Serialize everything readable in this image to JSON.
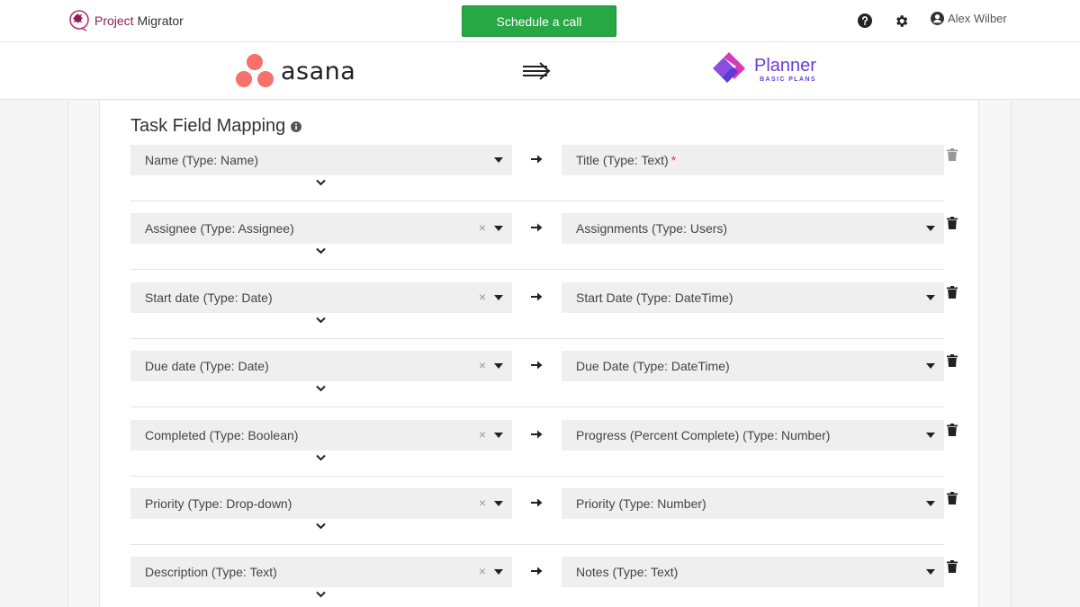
{
  "header": {
    "brand_part1": "Project",
    "brand_part2": "Migrator",
    "schedule_label": "Schedule a call",
    "user_name": "Alex Wilber"
  },
  "logos": {
    "source_name": "asana",
    "target_name": "Planner",
    "target_sub": "BASIC PLANS"
  },
  "section": {
    "title": "Task Field Mapping"
  },
  "mappings": [
    {
      "source": "Name (Type: Name)",
      "target": "Title (Type: Text)",
      "required": "*"
    },
    {
      "source": "Assignee (Type: Assignee)",
      "target": "Assignments (Type: Users)"
    },
    {
      "source": "Start date (Type: Date)",
      "target": "Start Date (Type: DateTime)"
    },
    {
      "source": "Due date (Type: Date)",
      "target": "Due Date (Type: DateTime)"
    },
    {
      "source": "Completed (Type: Boolean)",
      "target": "Progress (Percent Complete) (Type: Number)"
    },
    {
      "source": "Priority (Type: Drop-down)",
      "target": "Priority (Type: Number)"
    },
    {
      "source": "Description (Type: Text)",
      "target": "Notes (Type: Text)"
    }
  ],
  "icons": {
    "help": "question-circle-icon",
    "settings": "gear-icon",
    "user": "user-circle-icon",
    "info": "info-circle-icon",
    "map_arrow": "arrow-right-icon",
    "delete": "trash-icon",
    "expand": "chevron-down-icon",
    "clear": "clear-x-icon",
    "dropdown": "caret-down-icon"
  },
  "colors": {
    "brand": "#8e1e5a",
    "cta": "#27a844",
    "planner": "#6b3fd0",
    "required": "#e53935"
  }
}
